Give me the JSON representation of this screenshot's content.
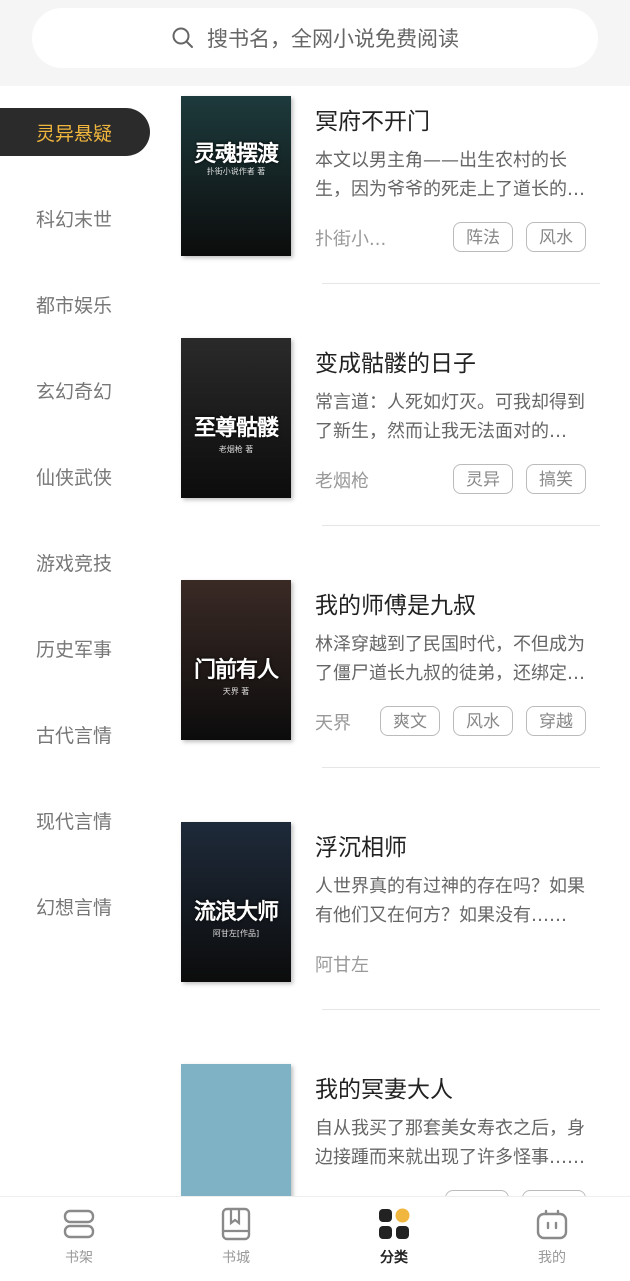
{
  "search": {
    "placeholder": "搜书名，全网小说免费阅读"
  },
  "sidebar": {
    "active_index": 0,
    "items": [
      {
        "label": "灵异悬疑"
      },
      {
        "label": "科幻末世"
      },
      {
        "label": "都市娱乐"
      },
      {
        "label": "玄幻奇幻"
      },
      {
        "label": "仙侠武侠"
      },
      {
        "label": "游戏竞技"
      },
      {
        "label": "历史军事"
      },
      {
        "label": "古代言情"
      },
      {
        "label": "现代言情"
      },
      {
        "label": "幻想言情"
      }
    ]
  },
  "books": [
    {
      "title": "冥府不开门",
      "desc": "本文以男主角——出生农村的长生，因为爷爷的死走上了道长的道路……",
      "author": "扑街小...",
      "tags": [
        "阵法",
        "风水"
      ],
      "cover_title": "灵魂摆渡",
      "cover_author": "扑街小说作者 著",
      "cover_color": "#1d3a3c"
    },
    {
      "title": "变成骷髅的日子",
      "desc": "常言道：人死如灯灭。可我却得到了新生，然而让我无法面对的是……",
      "author": "老烟枪",
      "tags": [
        "灵异",
        "搞笑"
      ],
      "cover_title": "至尊骷髅",
      "cover_author": "老烟枪 著",
      "cover_color": "#2a2a2a"
    },
    {
      "title": "我的师傅是九叔",
      "desc": "林泽穿越到了民国时代，不但成为了僵尸道长九叔的徒弟，还绑定了系统……",
      "author": "天界",
      "tags": [
        "爽文",
        "风水",
        "穿越"
      ],
      "cover_title": "门前有人",
      "cover_author": "天界 著",
      "cover_color": "#3a2a25"
    },
    {
      "title": "浮沉相师",
      "desc": " 人世界真的有过神的存在吗？如果有他们又在何方？如果没有……",
      "author": "阿甘左",
      "tags": [],
      "cover_title": "流浪大师",
      "cover_author": "阿甘左[作品]",
      "cover_color": "#1e2a3a"
    },
    {
      "title": "我的冥妻大人",
      "desc": "自从我买了那套美女寿衣之后，身边接踵而来就出现了许多怪事……",
      "author": "",
      "tags": [
        "",
        ""
      ],
      "cover_title": "",
      "cover_author": "",
      "cover_color": "#7fb2c4"
    }
  ],
  "nav": {
    "active_index": 2,
    "items": [
      {
        "label": "书架",
        "icon": "bookshelf-icon"
      },
      {
        "label": "书城",
        "icon": "bookstore-icon"
      },
      {
        "label": "分类",
        "icon": "category-icon"
      },
      {
        "label": "我的",
        "icon": "profile-icon"
      }
    ]
  },
  "colors": {
    "accent": "#f0b63e",
    "active_bg": "#2b2b2b",
    "header_bg": "#f5f5f5"
  }
}
